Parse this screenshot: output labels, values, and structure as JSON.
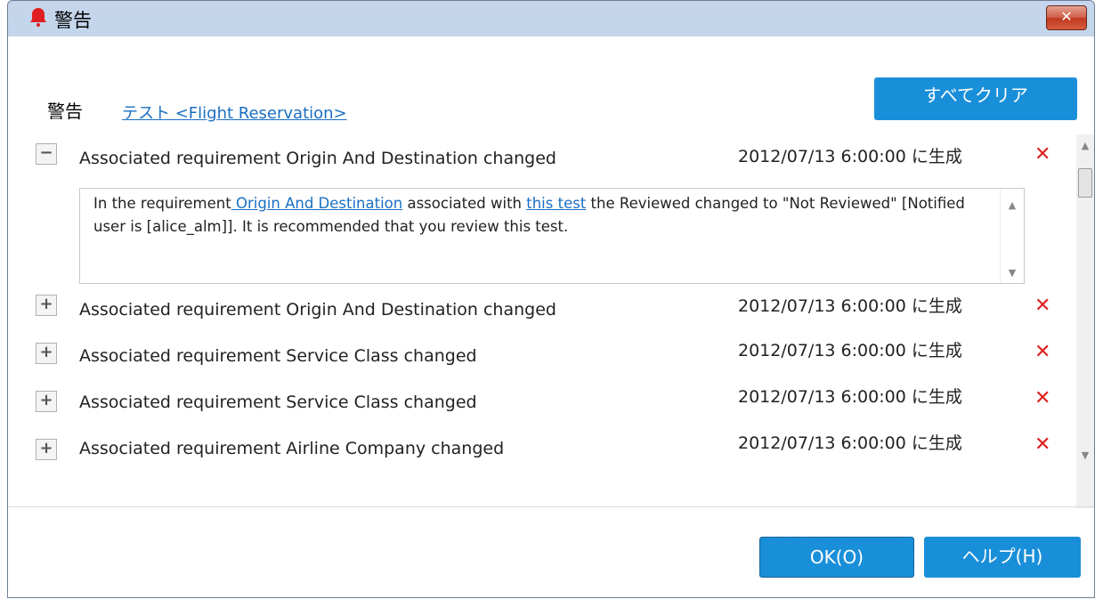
{
  "window": {
    "title": "警告",
    "close_label": "✕"
  },
  "header": {
    "label": "警告",
    "test_link": "テスト <Flight Reservation>",
    "clear_all_label": "すべてクリア"
  },
  "alerts": [
    {
      "toggle": "−",
      "title": "Associated requirement Origin And Destination changed",
      "date": "2012/07/13 6:00:00 に生成",
      "delete": "✕"
    },
    {
      "toggle": "+",
      "title": "Associated requirement Origin And Destination changed",
      "date": "2012/07/13 6:00:00 に生成",
      "delete": "✕"
    },
    {
      "toggle": "+",
      "title": "Associated requirement Service Class changed",
      "date": "2012/07/13 6:00:00 に生成",
      "delete": "✕"
    },
    {
      "toggle": "+",
      "title": "Associated requirement Service Class changed",
      "date": "2012/07/13 6:00:00 に生成",
      "delete": "✕"
    },
    {
      "toggle": "+",
      "title": "Associated requirement Airline Company changed",
      "date": "2012/07/13 6:00:00 に生成",
      "delete": "✕"
    }
  ],
  "detail": {
    "part1": "In the requirement",
    "link1": " Origin And Destination",
    "part2": " associated with ",
    "link2": "this test",
    "part3": " the Reviewed changed to \"Not Reviewed\" [Notified user is [alice_alm]]. It is recommended that you review this test."
  },
  "footer": {
    "ok_label": "OK(O)",
    "help_label": "ヘルプ(H)"
  },
  "colors": {
    "accent": "#1a8fd9",
    "delete": "#e02020",
    "link": "#1a6fc2"
  }
}
